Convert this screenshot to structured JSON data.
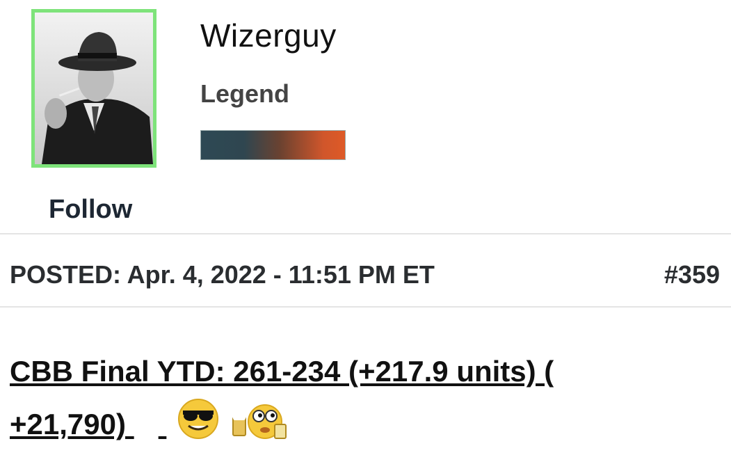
{
  "profile": {
    "username": "Wizerguy",
    "rank": "Legend",
    "rank_bar_colors": [
      "#2e4954",
      "#de5a27"
    ],
    "follow_label": "Follow",
    "avatar_border_color": "#7ee37a"
  },
  "post": {
    "posted": "POSTED: Apr. 4, 2022 - 11:51 PM ET",
    "number": "#359",
    "line1": "CBB Final YTD: 261-234 (+217.9 units) (",
    "line2": "+21,790) ",
    "emojis": [
      "sunglasses-emoji-icon",
      "beer-toast-emoji-icon"
    ]
  }
}
